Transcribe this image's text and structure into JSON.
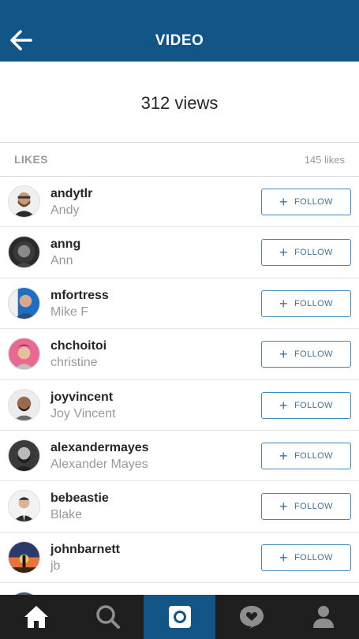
{
  "header": {
    "title": "VIDEO",
    "back_icon": "arrow-left-icon",
    "bg_color": "#125688"
  },
  "views": {
    "text": "312 views"
  },
  "likes": {
    "title": "LIKES",
    "count": "145 likes"
  },
  "follow_label": "FOLLOW",
  "follow_plus": "+",
  "users": [
    {
      "username": "andytlr",
      "name": "Andy"
    },
    {
      "username": "anng",
      "name": "Ann"
    },
    {
      "username": "mfortress",
      "name": "Mike F"
    },
    {
      "username": "chchoitoi",
      "name": "christine"
    },
    {
      "username": "joyvincent",
      "name": "Joy Vincent"
    },
    {
      "username": "alexandermayes",
      "name": "Alexander Mayes"
    },
    {
      "username": "bebeastie",
      "name": "Blake"
    },
    {
      "username": "johnbarnett",
      "name": "jb"
    }
  ],
  "tabbar": {
    "tabs": [
      "home-icon",
      "search-icon",
      "camera-icon",
      "activity-heart-icon",
      "profile-icon"
    ],
    "active_index": 2
  }
}
